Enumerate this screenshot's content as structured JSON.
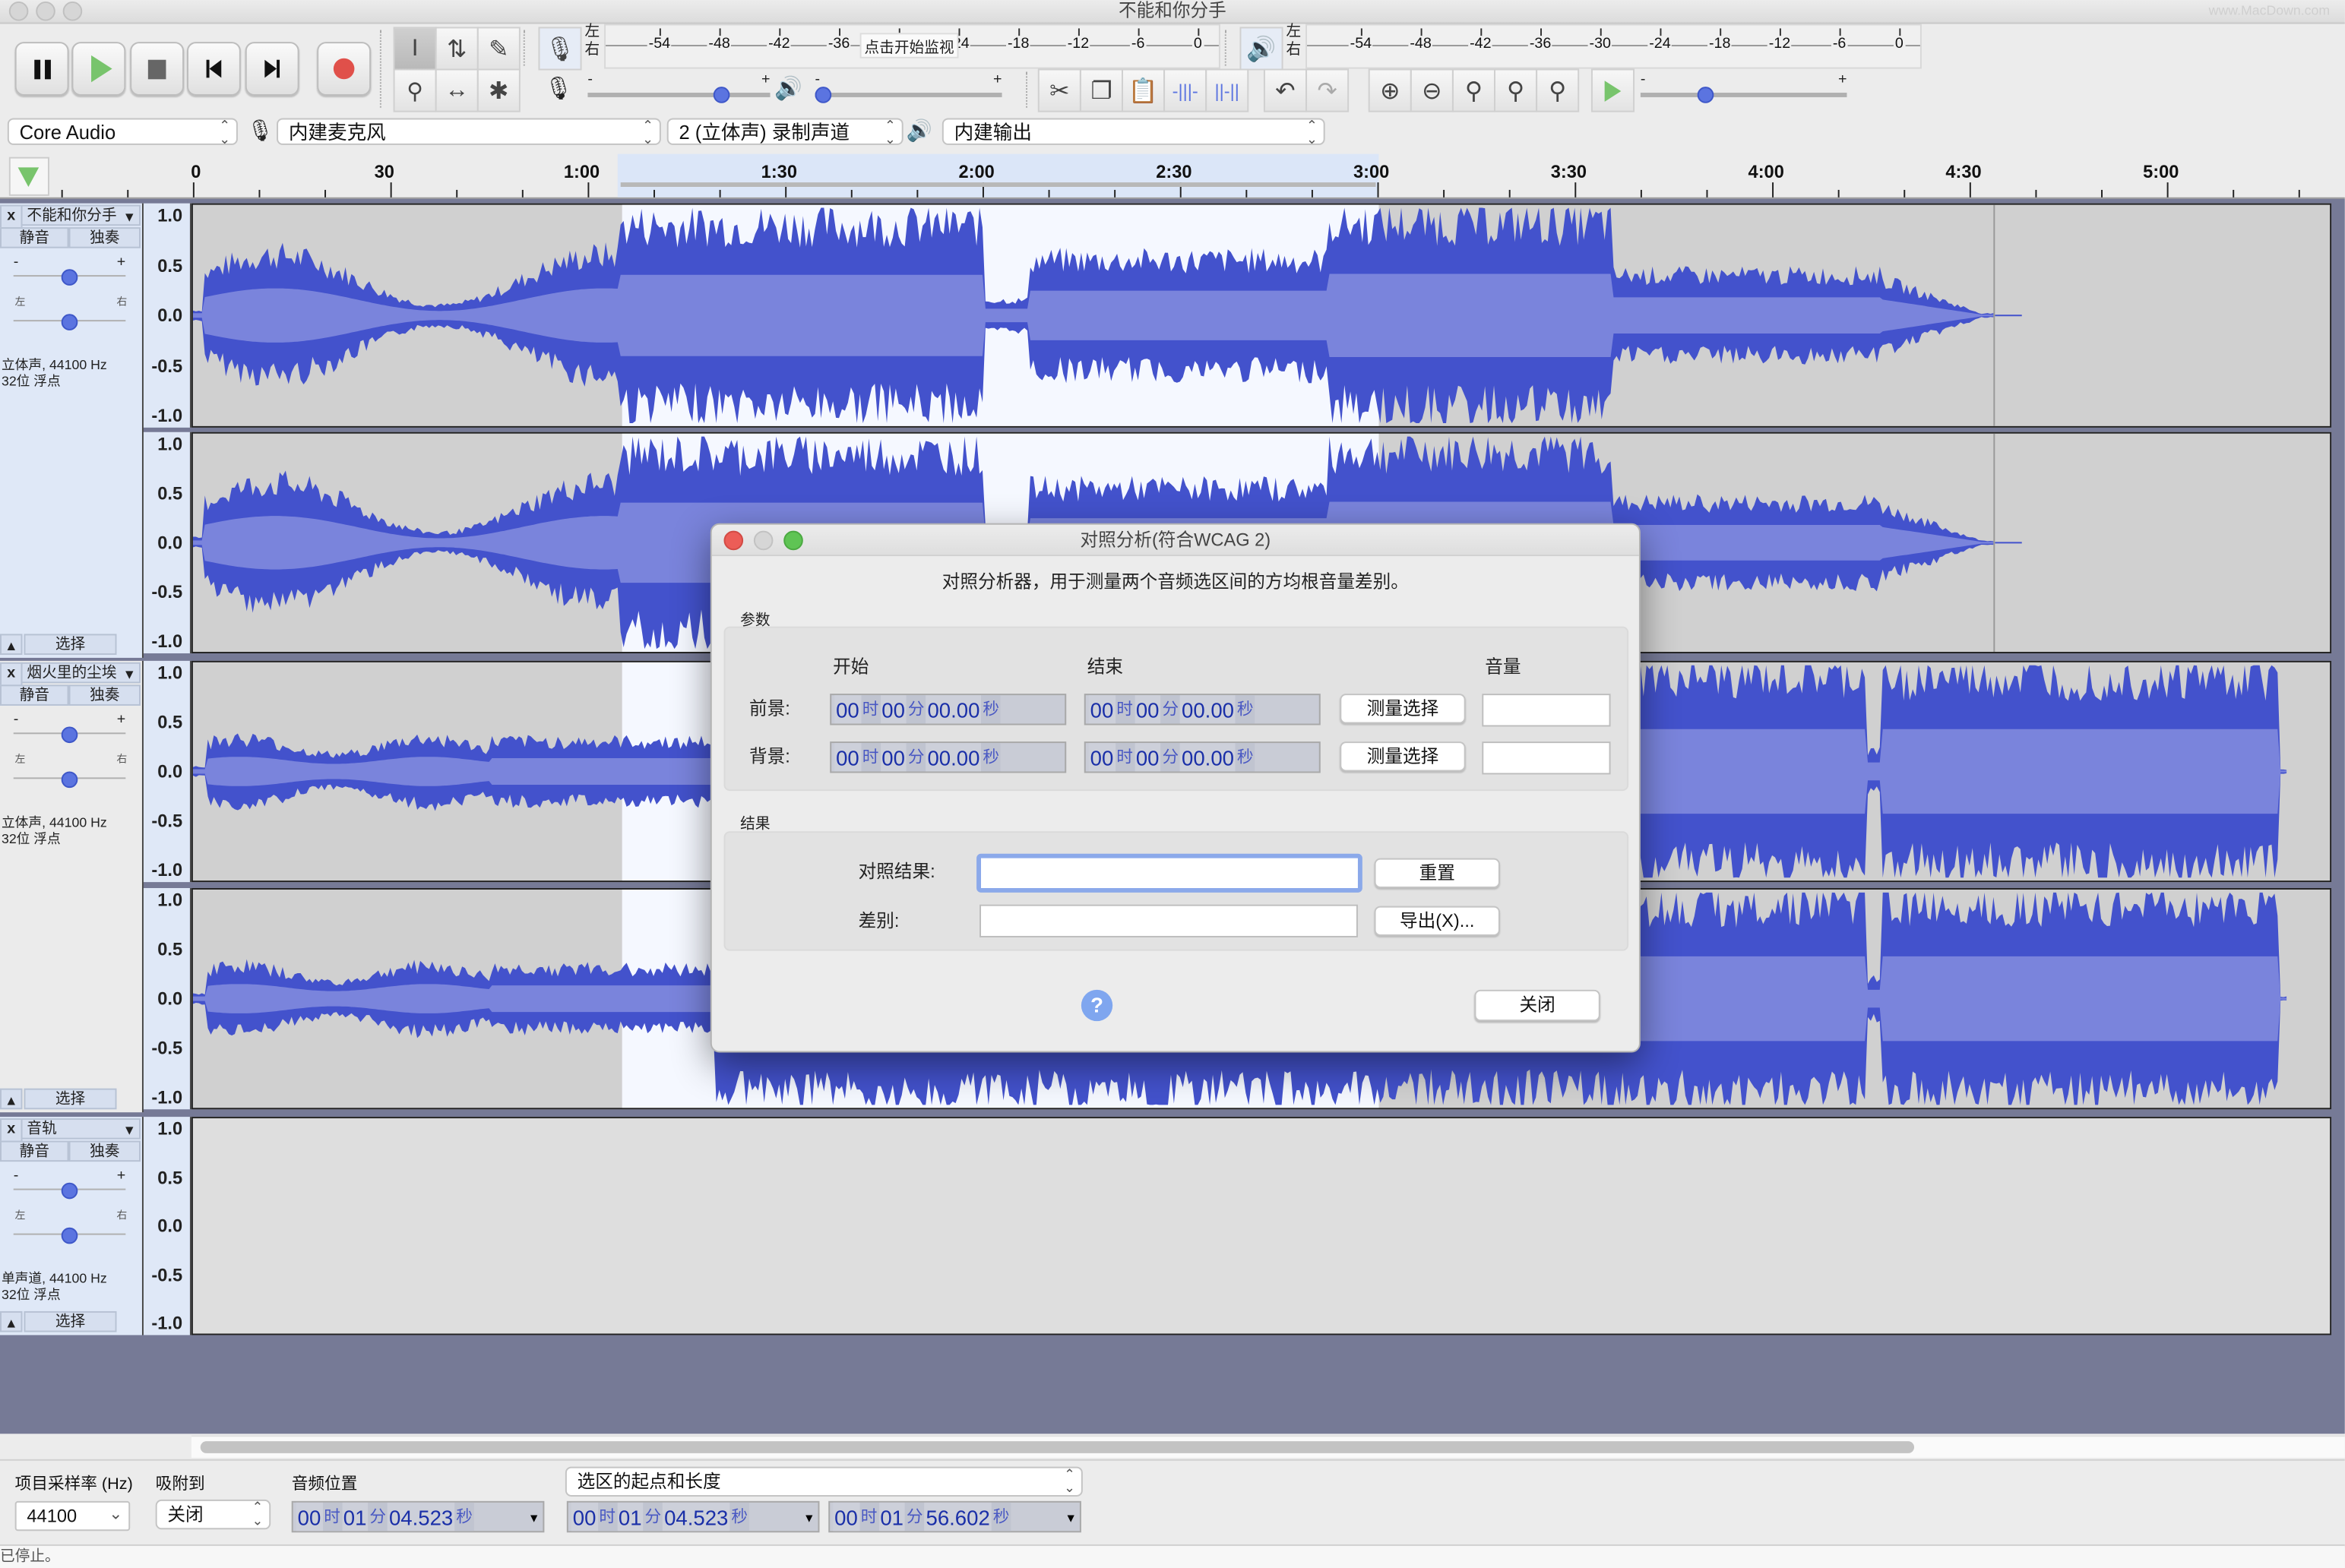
{
  "window": {
    "title": "不能和你分手",
    "watermark": "www.MacDown.com"
  },
  "transport": {
    "pause": "pause-icon",
    "play": "play-icon",
    "stop": "stop-icon",
    "skip_start": "skip-to-start-icon",
    "skip_end": "skip-to-end-icon",
    "record": "record-icon"
  },
  "tools": {
    "row1": [
      "I",
      "⇅",
      "✎"
    ],
    "row2": [
      "🔍",
      "↔",
      "✱"
    ]
  },
  "record_meter": {
    "left_label": "左",
    "right_label": "右",
    "ticks": [
      "-54",
      "-48",
      "-42",
      "-36",
      "-30",
      "-24",
      "-18",
      "-12",
      "-6",
      "0"
    ],
    "monitor_hint": "点击开始监视"
  },
  "play_meter": {
    "left_label": "左",
    "right_label": "右",
    "ticks": [
      "-54",
      "-48",
      "-42",
      "-36",
      "-30",
      "-24",
      "-18",
      "-12",
      "-6",
      "0"
    ]
  },
  "mixer": {
    "record_volume": 0.75,
    "playback_volume": 0.0,
    "minus": "-",
    "plus": "+"
  },
  "play_at_speed": {
    "value": 0.3,
    "minus": "-",
    "plus": "+"
  },
  "devices": {
    "host": "Core Audio",
    "input": "内建麦克风",
    "channels": "2 (立体声) 录制声道",
    "output": "内建输出"
  },
  "timeline": {
    "labels": [
      "0",
      "30",
      "1:00",
      "1:30",
      "2:00",
      "2:30",
      "3:00",
      "3:30",
      "4:00",
      "4:30",
      "5:00"
    ],
    "selection_start": "1:04.523",
    "selection_end": "3:01.125"
  },
  "tracks": [
    {
      "name": "不能和你分手",
      "mute": "静音",
      "solo": "独奏",
      "gain_minus": "-",
      "gain_plus": "+",
      "pan_left": "左",
      "pan_right": "右",
      "info_line1": "立体声, 44100 Hz",
      "info_line2": "32位 浮点",
      "select": "选择",
      "scale": [
        "1.0",
        "0.5",
        "0.0",
        "-0.5",
        "-1.0"
      ]
    },
    {
      "name": "烟火里的尘埃",
      "mute": "静音",
      "solo": "独奏",
      "gain_minus": "-",
      "gain_plus": "+",
      "pan_left": "左",
      "pan_right": "右",
      "info_line1": "立体声, 44100 Hz",
      "info_line2": "32位 浮点",
      "select": "选择",
      "scale": [
        "1.0",
        "0.5",
        "0.0",
        "-0.5",
        "-1.0"
      ]
    },
    {
      "name": "音轨",
      "mute": "静音",
      "solo": "独奏",
      "gain_minus": "-",
      "gain_plus": "+",
      "pan_left": "左",
      "pan_right": "右",
      "info_line1": "单声道, 44100 Hz",
      "info_line2": "32位 浮点",
      "select": "选择",
      "scale": [
        "1.0",
        "0.5",
        "0.0",
        "-0.5",
        "-1.0"
      ]
    }
  ],
  "dialog": {
    "title": "对照分析(符合WCAG 2)",
    "description": "对照分析器，用于测量两个音频选区间的方均根音量差别。",
    "params_label": "参数",
    "col_start": "开始",
    "col_end": "结束",
    "col_volume": "音量",
    "foreground_label": "前景:",
    "background_label": "背景:",
    "time_parts": [
      "00",
      "时",
      "00",
      "分",
      "00.00",
      "秒"
    ],
    "measure_button": "测量选择",
    "foreground_volume": "",
    "background_volume": "",
    "results_label": "结果",
    "contrast_result_label": "对照结果:",
    "contrast_result_value": "",
    "difference_label": "差别:",
    "difference_value": "",
    "reset_button": "重置",
    "export_button": "导出(X)...",
    "help_button": "?",
    "close_button": "关闭"
  },
  "selection_toolbar": {
    "rate_label": "项目采样率 (Hz)",
    "rate_value": "44100",
    "snap_label": "吸附到",
    "snap_value": "关闭",
    "position_label": "音频位置",
    "selection_mode": "选区的起点和长度",
    "audio_position": [
      "00",
      "时",
      "01",
      "分",
      "04.523",
      "秒"
    ],
    "selection_start": [
      "00",
      "时",
      "01",
      "分",
      "04.523",
      "秒"
    ],
    "selection_length": [
      "00",
      "时",
      "01",
      "分",
      "56.602",
      "秒"
    ]
  },
  "status": {
    "text": "已停止。"
  },
  "colors": {
    "waveform": "#4352cc",
    "waveform_rms": "#7a84dc",
    "selection_bg": "#f5f8ff",
    "track_bg": "#d0d0d0",
    "track_area_bg": "#767a96",
    "record_red": "#e0504a",
    "play_green": "#78c46c"
  }
}
